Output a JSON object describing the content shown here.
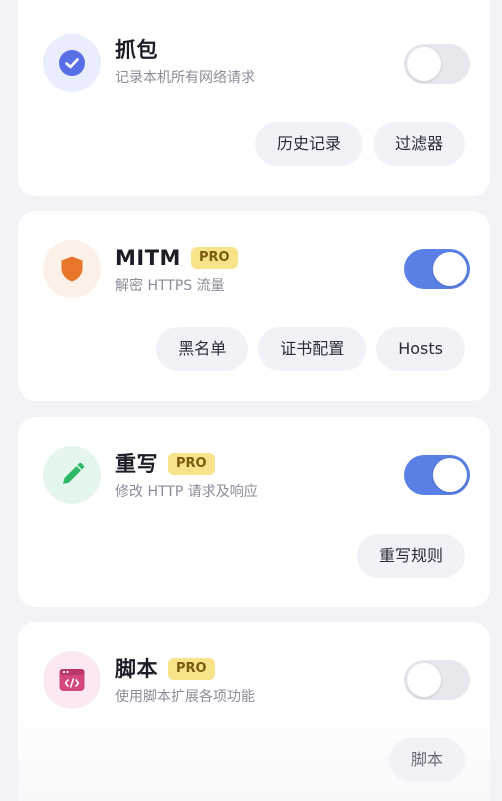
{
  "cards": [
    {
      "title": "抓包",
      "subtitle": "记录本机所有网络请求",
      "pro": "",
      "toggle_on": false,
      "icon": "check-circle-icon",
      "buttons": [
        "历史记录",
        "过滤器"
      ]
    },
    {
      "title": "MITM",
      "subtitle": "解密 HTTPS 流量",
      "pro": "PRO",
      "toggle_on": true,
      "icon": "shield-icon",
      "buttons": [
        "黑名单",
        "证书配置",
        "Hosts"
      ]
    },
    {
      "title": "重写",
      "subtitle": "修改 HTTP 请求及响应",
      "pro": "PRO",
      "toggle_on": true,
      "icon": "pencil-icon",
      "buttons": [
        "重写规则"
      ]
    },
    {
      "title": "脚本",
      "subtitle": "使用脚本扩展各项功能",
      "pro": "PRO",
      "toggle_on": false,
      "icon": "code-window-icon",
      "buttons": [
        "脚本"
      ]
    }
  ],
  "colors": {
    "accent": "#5a7fe6",
    "pro_badge": "#f8e28a",
    "capture_icon": "#5a6ee6",
    "mitm_icon": "#e8762a",
    "rewrite_icon": "#2fb866",
    "script_icon": "#d2487e"
  }
}
